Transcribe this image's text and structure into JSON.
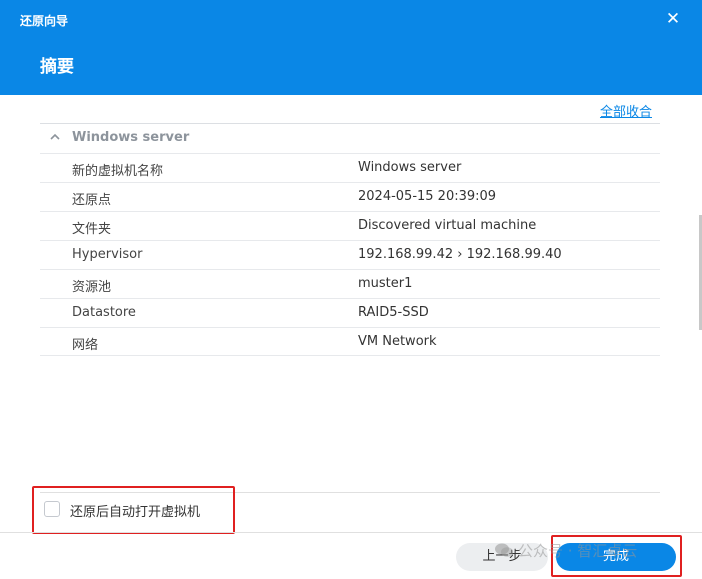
{
  "window": {
    "title": "还原向导",
    "close_glyph": "✕",
    "heading": "摘要"
  },
  "collapse_all": "全部收合",
  "section": {
    "title": "Windows server",
    "rows": [
      {
        "key": "新的虚拟机名称",
        "value": "Windows server"
      },
      {
        "key": "还原点",
        "value": "2024-05-15 20:39:09"
      },
      {
        "key": "文件夹",
        "value": "Discovered virtual machine"
      },
      {
        "key": "Hypervisor",
        "value": "192.168.99.42 › 192.168.99.40"
      },
      {
        "key": "资源池",
        "value": "muster1"
      },
      {
        "key": "Datastore",
        "value": "RAID5-SSD"
      },
      {
        "key": "网络",
        "value": "VM Network"
      }
    ]
  },
  "auto_power_on": {
    "label": "还原后自动打开虚拟机",
    "checked": false
  },
  "buttons": {
    "prev": "上一步",
    "finish": "完成"
  },
  "watermark": "公众号 · 智汇卓云",
  "colors": {
    "header": "#0a87e6",
    "primary_button": "#0a87e6",
    "highlight": "#e02020"
  }
}
